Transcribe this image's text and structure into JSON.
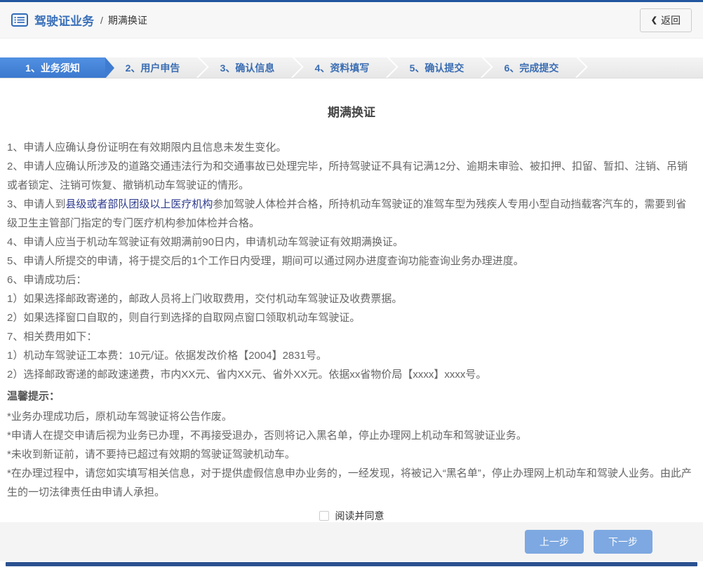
{
  "colors": {
    "top_line": "#2257a0",
    "active_step": "#3f7cd1",
    "step_text": "#3a6db3",
    "link": "#2d3a8c",
    "button": "#7da8e1",
    "bottom_bar": "#2a5190"
  },
  "header": {
    "icon": "list-icon",
    "section_label": "驾驶证业务",
    "separator": "/",
    "page_label": "期满换证",
    "back": {
      "icon": "chevron-left-icon",
      "glyph": "❮",
      "label": "返回"
    }
  },
  "steps": [
    {
      "label": "1、业务须知",
      "active": true
    },
    {
      "label": "2、用户申告",
      "active": false
    },
    {
      "label": "3、确认信息",
      "active": false
    },
    {
      "label": "4、资料填写",
      "active": false
    },
    {
      "label": "5、确认提交",
      "active": false
    },
    {
      "label": "6、完成提交",
      "active": false
    }
  ],
  "content": {
    "title": "期满换证",
    "paragraphs": [
      {
        "text": "1、申请人应确认身份证明在有效期限内且信息未发生变化。"
      },
      {
        "text": "2、申请人应确认所涉及的道路交通违法行为和交通事故已处理完毕，所持驾驶证不具有记满12分、逾期未审验、被扣押、扣留、暂扣、注销、吊销或者锁定、注销可恢复、撤销机动车驾驶证的情形。"
      },
      {
        "parts": [
          {
            "t": "3、申请人到"
          },
          {
            "t": "县级或者部队团级以上医疗机构",
            "link": true
          },
          {
            "t": "参加驾驶人体检并合格，所持机动车驾驶证的准驾车型为残疾人专用小型自动挡载客汽车的，需要到省级卫生主管部门指定的专门医疗机构参加体检并合格。"
          }
        ]
      },
      {
        "text": "4、申请人应当于机动车驾驶证有效期满前90日内，申请机动车驾驶证有效期满换证。"
      },
      {
        "text": "5、申请人所提交的申请，将于提交后的1个工作日内受理，期间可以通过网办进度查询功能查询业务办理进度。"
      },
      {
        "text": "6、申请成功后："
      },
      {
        "text": "1）如果选择邮政寄递的，邮政人员将上门收取费用，交付机动车驾驶证及收费票据。"
      },
      {
        "text": "2）如果选择窗口自取的，则自行到选择的自取网点窗口领取机动车驾驶证。"
      },
      {
        "text": "7、相关费用如下："
      },
      {
        "text": "1）机动车驾驶证工本费：10元/证。依据发改价格【2004】2831号。"
      },
      {
        "text": "2）选择邮政寄递的邮政速递费，市内XX元、省内XX元、省外XX元。依据xx省物价局【xxxx】xxxx号。"
      }
    ],
    "notice_title": "温馨提示：",
    "notices": [
      "*业务办理成功后，原机动车驾驶证将公告作废。",
      "*申请人在提交申请后视为业务已办理，不再接受退办，否则将记入黑名单，停止办理网上机动车和驾驶证业务。",
      "*未收到新证前，请不要持已超过有效期的驾驶证驾驶机动车。",
      "*在办理过程中，请您如实填写相关信息，对于提供虚假信息申办业务的，一经发现，将被记入“黑名单”，停止办理网上机动车和驾驶人业务。由此产生的一切法律责任由申请人承担。"
    ]
  },
  "agreement": {
    "label": "阅读并同意",
    "checked": false
  },
  "footer": {
    "prev_label": "上一步",
    "next_label": "下一步"
  }
}
